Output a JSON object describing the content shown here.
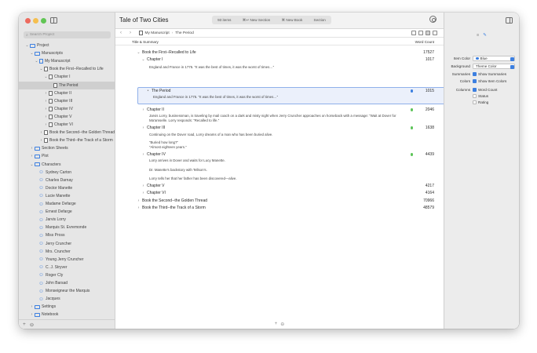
{
  "sidebar": {
    "search_placeholder": "Search Project",
    "items": [
      {
        "label": "Project",
        "chev": "⌄",
        "icon": "folder",
        "indent": 0
      },
      {
        "label": "Manuscripts",
        "chev": "⌄",
        "icon": "folder",
        "indent": 1
      },
      {
        "label": "My Manuscript",
        "chev": "⌄",
        "icon": "doc",
        "indent": 2
      },
      {
        "label": "Book the First--Recalled to Life",
        "chev": "⌄",
        "icon": "",
        "indent": 3
      },
      {
        "label": "Chapter I",
        "chev": "⌄",
        "icon": "",
        "indent": 4
      },
      {
        "label": "The Period",
        "chev": "",
        "icon": "",
        "indent": 5,
        "selected": true
      },
      {
        "label": "Chapter II",
        "chev": "›",
        "icon": "",
        "indent": 4
      },
      {
        "label": "Chapter III",
        "chev": "›",
        "icon": "",
        "indent": 4
      },
      {
        "label": "Chapter IV",
        "chev": "›",
        "icon": "",
        "indent": 4
      },
      {
        "label": "Chapter V",
        "chev": "›",
        "icon": "",
        "indent": 4
      },
      {
        "label": "Chapter VI",
        "chev": "›",
        "icon": "",
        "indent": 4
      },
      {
        "label": "Book the Second--the Golden Thread",
        "chev": "›",
        "icon": "",
        "indent": 3
      },
      {
        "label": "Book the Third--the Track of a Storm",
        "chev": "›",
        "icon": "",
        "indent": 3
      },
      {
        "label": "Section Sheets",
        "chev": "›",
        "icon": "folder",
        "indent": 1
      },
      {
        "label": "Plot",
        "chev": "›",
        "icon": "folder",
        "indent": 1
      },
      {
        "label": "Characters",
        "chev": "⌄",
        "icon": "folder",
        "indent": 1
      },
      {
        "label": "Sydney Carton",
        "chev": "",
        "icon": "char",
        "indent": 2
      },
      {
        "label": "Charles Darnay",
        "chev": "",
        "icon": "char",
        "indent": 2
      },
      {
        "label": "Doctor Manette",
        "chev": "",
        "icon": "char",
        "indent": 2
      },
      {
        "label": "Lucie Manette",
        "chev": "",
        "icon": "char",
        "indent": 2
      },
      {
        "label": "Madame Defarge",
        "chev": "",
        "icon": "char",
        "indent": 2
      },
      {
        "label": "Ernest Defarge",
        "chev": "",
        "icon": "char",
        "indent": 2
      },
      {
        "label": "Jarvis Lorry",
        "chev": "",
        "icon": "char",
        "indent": 2
      },
      {
        "label": "Marquis St. Evremonde",
        "chev": "",
        "icon": "char",
        "indent": 2
      },
      {
        "label": "Miss Pross",
        "chev": "",
        "icon": "char",
        "indent": 2
      },
      {
        "label": "Jerry Cruncher",
        "chev": "",
        "icon": "char",
        "indent": 2
      },
      {
        "label": "Mrs. Cruncher",
        "chev": "",
        "icon": "char",
        "indent": 2
      },
      {
        "label": "Young Jerry Cruncher",
        "chev": "",
        "icon": "char",
        "indent": 2
      },
      {
        "label": "C. J. Stryver",
        "chev": "",
        "icon": "char",
        "indent": 2
      },
      {
        "label": "Roger Cly",
        "chev": "",
        "icon": "char",
        "indent": 2
      },
      {
        "label": "John Barsad",
        "chev": "",
        "icon": "char",
        "indent": 2
      },
      {
        "label": "Monseigneur the Marquis",
        "chev": "",
        "icon": "char",
        "indent": 2
      },
      {
        "label": "Jacques",
        "chev": "",
        "icon": "char",
        "indent": 2
      },
      {
        "label": "Settings",
        "chev": "›",
        "icon": "folder",
        "indent": 1
      },
      {
        "label": "Notebook",
        "chev": "›",
        "icon": "folder",
        "indent": 1
      }
    ],
    "bottom_add": "+",
    "bottom_more": "⊖"
  },
  "header": {
    "title": "Tale of Two Cities",
    "toolbar": {
      "items_count": "93 items",
      "new_section": "⌘↩ New Section",
      "new_book": "⌘ New Book",
      "section": "Section"
    }
  },
  "pathbar": {
    "crumb1": "My Manuscript",
    "sep": "›",
    "crumb2": "The Period"
  },
  "columns": {
    "title": "Title & Summary",
    "word_count": "Word Count"
  },
  "outline": {
    "book1": {
      "title": "Book the First--Recalled to Life",
      "wc": "17527"
    },
    "ch1": {
      "title": "Chapter I",
      "wc": "1017",
      "summary": "England and France in 1775. “It was the best of times, it was the worst of times…”"
    },
    "period": {
      "title": "The Period",
      "wc": "1015",
      "summary": "England and France in 1775. “It was the best of times, it was the worst of times…”"
    },
    "ch2": {
      "title": "Chapter II",
      "wc": "2046",
      "summary1": "Jarvis Lorry, businessman, is traveling by mail coach on a dark and misty night when Jerry Cruncher approaches on horseback with a message: “Wait at Dover for",
      "summary2": "Ma'amselle. Lorry responds: “Recalled to life.”"
    },
    "ch3": {
      "title": "Chapter III",
      "wc": "1638",
      "summary1": "Continuing on the Dover road, Lorry dreams of a man who has been buried alive.",
      "summary2": "“Buried how long?”",
      "summary3": "“Almost eighteen years.”"
    },
    "ch4": {
      "title": "Chapter IV",
      "wc": "4439",
      "summary1": "Lorry arrives in Dover and waits for Lucy Manette.",
      "summary2": "Dr. Manette's backstory with Tellson's.",
      "summary3": "Lorry tells her that her father has been discovered—alive."
    },
    "ch5": {
      "title": "Chapter V",
      "wc": "4217"
    },
    "ch6": {
      "title": "Chapter VI",
      "wc": "4164"
    },
    "book2": {
      "title": "Book the Second--the Golden Thread",
      "wc": "70966"
    },
    "book3": {
      "title": "Book the Third--the Track of a Storm",
      "wc": "48579"
    }
  },
  "inspector": {
    "item_color_label": "Item Color",
    "item_color_value": "Blue",
    "background_label": "Background",
    "background_value": "Theme Color",
    "summaries_label": "Summaries",
    "summaries_value": "Show Summaries",
    "colors_label": "Colors",
    "colors_value": "Show Item Colors",
    "columns_label": "Columns",
    "col_word_count": "Word Count",
    "col_status": "Status",
    "col_rating": "Rating"
  },
  "colors": {
    "accent": "#3c7fe0",
    "status_green": "#5ec45a",
    "selected_card_bg": "#ebf0fb"
  },
  "main_bottom": {
    "add": "+",
    "more": "⊖"
  }
}
